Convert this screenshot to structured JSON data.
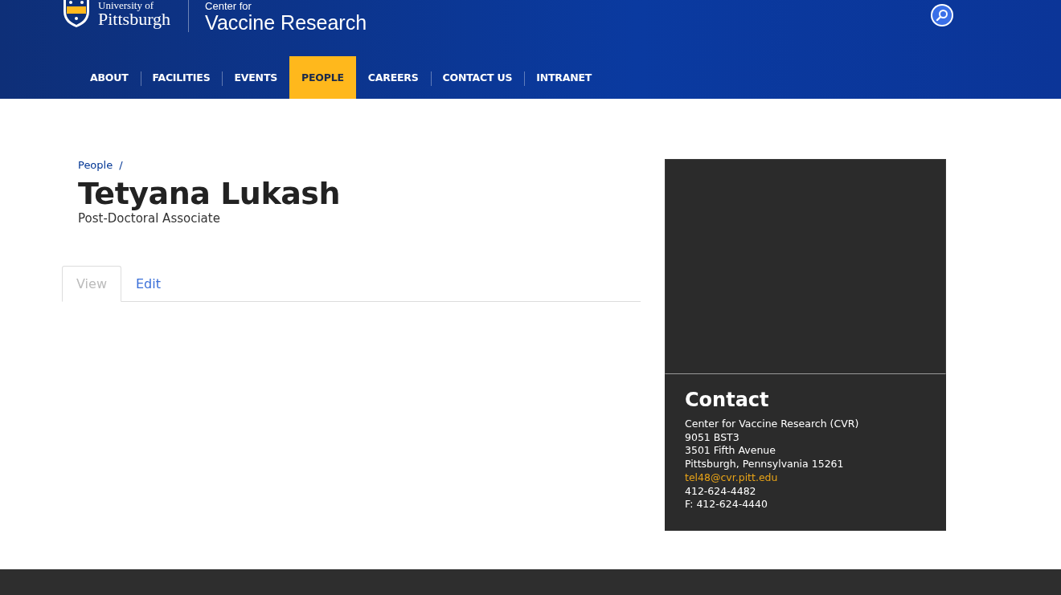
{
  "header": {
    "university": [
      "University of",
      "Pittsburgh"
    ],
    "site_kicker": "Center for",
    "site_title": "Vaccine Research"
  },
  "nav": [
    {
      "label": "ABOUT",
      "selected": false
    },
    {
      "label": "FACILITIES",
      "selected": false
    },
    {
      "label": "EVENTS",
      "selected": false
    },
    {
      "label": "PEOPLE",
      "selected": true
    },
    {
      "label": "CAREERS",
      "selected": false
    },
    {
      "label": "CONTACT US",
      "selected": false
    },
    {
      "label": "INTRANET",
      "selected": false
    }
  ],
  "breadcrumb": [
    {
      "label": "People",
      "separator": "/"
    }
  ],
  "person": {
    "name": "Tetyana Lukash",
    "title": "Post-Doctoral Associate"
  },
  "tabs": [
    {
      "label": "View",
      "selected": true
    },
    {
      "label": "Edit",
      "selected": false
    }
  ],
  "contact": {
    "heading": "Contact",
    "lines": [
      {
        "kind": "text",
        "text": "Center for Vaccine Research (CVR)"
      },
      {
        "kind": "text",
        "text": "9051 BST3"
      },
      {
        "kind": "text",
        "text": "3501 Fifth Avenue"
      },
      {
        "kind": "text",
        "text": "Pittsburgh, Pennsylvania 15261"
      },
      {
        "kind": "email",
        "text": "tel48@cvr.pitt.edu"
      },
      {
        "kind": "text",
        "text": "412-624-4482"
      },
      {
        "kind": "text",
        "text": "F: 412-624-4440"
      }
    ]
  }
}
